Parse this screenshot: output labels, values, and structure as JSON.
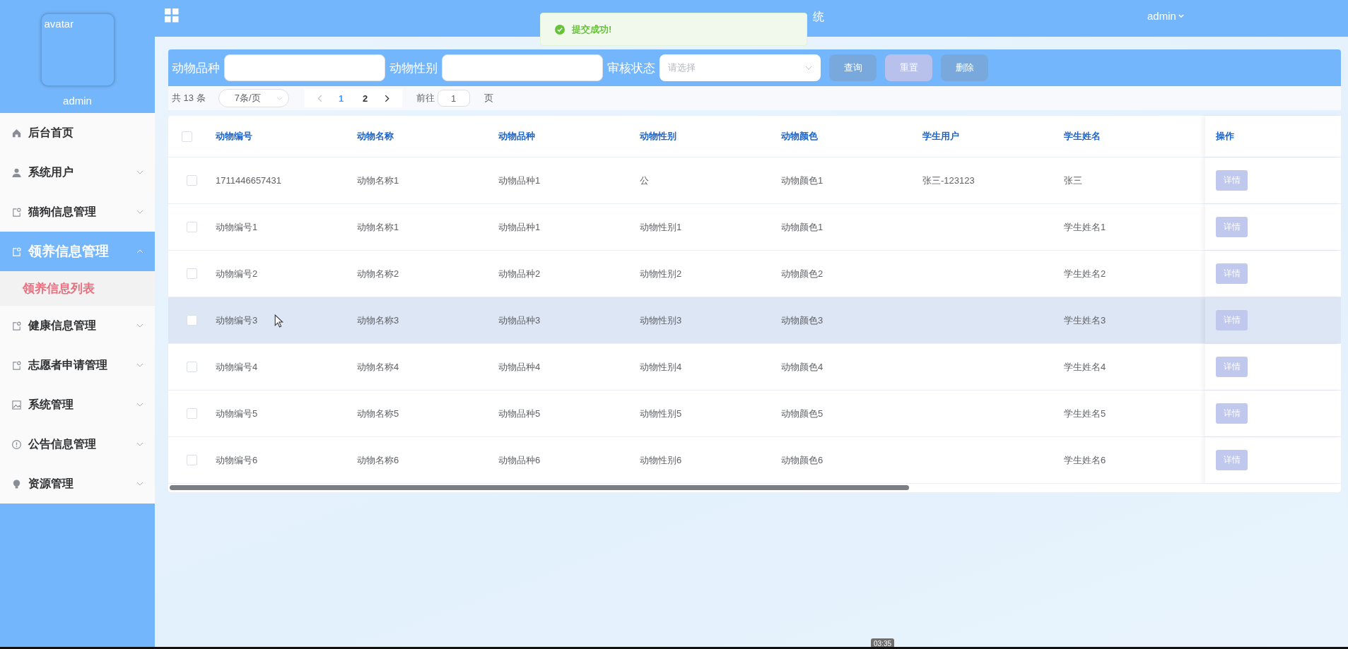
{
  "header": {
    "title": "统",
    "user": "admin"
  },
  "toast": {
    "message": "提交成功!"
  },
  "sidebar": {
    "avatar_alt": "avatar",
    "username": "admin",
    "items": [
      {
        "label": "后台首页",
        "kind": "link",
        "expanded": false
      },
      {
        "label": "系统用户",
        "kind": "submenu",
        "expanded": false
      },
      {
        "label": "猫狗信息管理",
        "kind": "submenu",
        "expanded": false
      },
      {
        "label": "领养信息管理",
        "kind": "submenu",
        "expanded": true,
        "children": [
          {
            "label": "领养信息列表",
            "selected": true
          }
        ]
      },
      {
        "label": "健康信息管理",
        "kind": "submenu",
        "expanded": false
      },
      {
        "label": "志愿者申请管理",
        "kind": "submenu",
        "expanded": false
      },
      {
        "label": "系统管理",
        "kind": "submenu",
        "expanded": false
      },
      {
        "label": "公告信息管理",
        "kind": "submenu",
        "expanded": false
      },
      {
        "label": "资源管理",
        "kind": "submenu",
        "expanded": false
      }
    ]
  },
  "filters": [
    {
      "label": "动物品种",
      "kind": "input"
    },
    {
      "label": "动物性别",
      "kind": "input"
    },
    {
      "label": "审核状态",
      "kind": "select",
      "placeholder": "请选择"
    }
  ],
  "buttons": [
    {
      "label": "查询",
      "color": "#78a8dc"
    },
    {
      "label": "重置",
      "color": "#b8c0ec"
    },
    {
      "label": "删除",
      "color": "#78a8dc"
    }
  ],
  "pagination": {
    "total": "共 13 条",
    "page_size": "7条/页",
    "pages": [
      {
        "label": "1",
        "selected": true
      },
      {
        "label": "2",
        "selected": false
      }
    ],
    "goto_label": "前往",
    "goto_value": "1",
    "goto_suffix": "页"
  },
  "table": {
    "all_checked": false,
    "columns": [
      "动物编号",
      "动物名称",
      "动物品种",
      "动物性别",
      "动物颜色",
      "学生用户",
      "学生姓名",
      "操作"
    ],
    "rows": [
      {
        "cells": [
          "1711446657431",
          "动物名称1",
          "动物品种1",
          "公",
          "动物颜色1",
          "张三-123123",
          "张三"
        ],
        "action": "详情",
        "checked": false,
        "hovered": false
      },
      {
        "cells": [
          "动物编号1",
          "动物名称1",
          "动物品种1",
          "动物性别1",
          "动物颜色1",
          "",
          "学生姓名1"
        ],
        "action": "详情",
        "checked": false,
        "hovered": false
      },
      {
        "cells": [
          "动物编号2",
          "动物名称2",
          "动物品种2",
          "动物性别2",
          "动物颜色2",
          "",
          "学生姓名2"
        ],
        "action": "详情",
        "checked": false,
        "hovered": false
      },
      {
        "cells": [
          "动物编号3",
          "动物名称3",
          "动物品种3",
          "动物性别3",
          "动物颜色3",
          "",
          "学生姓名3"
        ],
        "action": "详情",
        "checked": false,
        "hovered": true
      },
      {
        "cells": [
          "动物编号4",
          "动物名称4",
          "动物品种4",
          "动物性别4",
          "动物颜色4",
          "",
          "学生姓名4"
        ],
        "action": "详情",
        "checked": false,
        "hovered": false
      },
      {
        "cells": [
          "动物编号5",
          "动物名称5",
          "动物品种5",
          "动物性别5",
          "动物颜色5",
          "",
          "学生姓名5"
        ],
        "action": "详情",
        "checked": false,
        "hovered": false
      },
      {
        "cells": [
          "动物编号6",
          "动物名称6",
          "动物品种6",
          "动物性别6",
          "动物颜色6",
          "",
          "学生姓名6"
        ],
        "action": "详情",
        "checked": false,
        "hovered": false
      }
    ]
  },
  "video_time": "03:35"
}
